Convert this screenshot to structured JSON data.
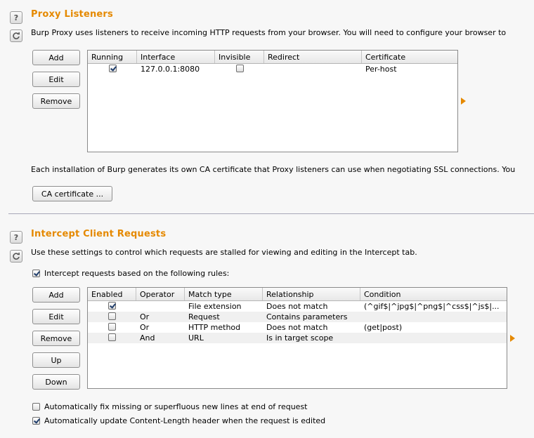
{
  "proxy_listeners": {
    "title": "Proxy Listeners",
    "description": "Burp Proxy uses listeners to receive incoming HTTP requests from your browser. You will need to configure your browser to",
    "buttons": {
      "add": "Add",
      "edit": "Edit",
      "remove": "Remove"
    },
    "columns": [
      "Running",
      "Interface",
      "Invisible",
      "Redirect",
      "Certificate"
    ],
    "rows": [
      {
        "running": true,
        "interface": "127.0.0.1:8080",
        "invisible": false,
        "redirect": "",
        "certificate": "Per-host"
      }
    ],
    "ca_description": "Each installation of Burp generates its own CA certificate that Proxy listeners can use when negotiating SSL connections. You",
    "ca_button": "CA certificate ..."
  },
  "intercept_client_requests": {
    "title": "Intercept Client Requests",
    "description": "Use these settings to control which requests are stalled for viewing and editing in the Intercept tab.",
    "rules_checkbox": {
      "label": "Intercept requests based on the following rules:",
      "checked": true
    },
    "buttons": {
      "add": "Add",
      "edit": "Edit",
      "remove": "Remove",
      "up": "Up",
      "down": "Down"
    },
    "columns": [
      "Enabled",
      "Operator",
      "Match type",
      "Relationship",
      "Condition"
    ],
    "rows": [
      {
        "enabled": true,
        "operator": "",
        "match_type": "File extension",
        "relationship": "Does not match",
        "condition": "(^gif$|^jpg$|^png$|^css$|^js$|..."
      },
      {
        "enabled": false,
        "operator": "Or",
        "match_type": "Request",
        "relationship": "Contains parameters",
        "condition": ""
      },
      {
        "enabled": false,
        "operator": "Or",
        "match_type": "HTTP method",
        "relationship": "Does not match",
        "condition": "(get|post)"
      },
      {
        "enabled": false,
        "operator": "And",
        "match_type": "URL",
        "relationship": "Is in target scope",
        "condition": ""
      }
    ],
    "options": [
      {
        "label": "Automatically fix missing or superfluous new lines at end of request",
        "checked": false
      },
      {
        "label": "Automatically update Content-Length header when the request is edited",
        "checked": true
      }
    ]
  },
  "icons": {
    "help": "help-icon",
    "refresh": "refresh-icon",
    "expand": "expand-arrow-icon"
  },
  "colors": {
    "section_title": "#e58900",
    "accent_arrow": "#e58900"
  }
}
